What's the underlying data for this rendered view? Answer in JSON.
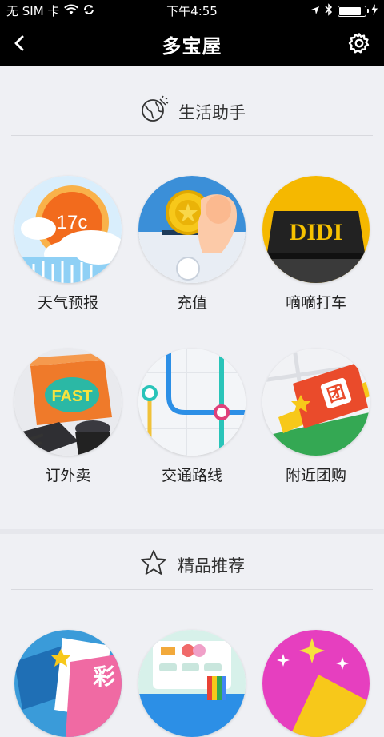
{
  "status_bar": {
    "carrier": "无 SIM 卡",
    "time": "下午4:55",
    "battery_level": 0.9
  },
  "nav": {
    "title": "多宝屋",
    "back_icon": "chevron-left-icon",
    "settings_icon": "gear-icon"
  },
  "sections": [
    {
      "title": "生活助手",
      "icon": "globe-icon",
      "items": [
        {
          "label": "天气预报",
          "icon": "weather-icon",
          "badge_text": "17c"
        },
        {
          "label": "充值",
          "icon": "recharge-coin-icon"
        },
        {
          "label": "嘀嘀打车",
          "icon": "didi-taxi-icon",
          "badge_text": "DIDI"
        },
        {
          "label": "订外卖",
          "icon": "delivery-scooter-icon",
          "badge_text": "FAST"
        },
        {
          "label": "交通路线",
          "icon": "transit-map-icon"
        },
        {
          "label": "附近团购",
          "icon": "group-buy-ticket-icon",
          "badge_text": "团"
        }
      ]
    },
    {
      "title": "精品推荐",
      "icon": "star-outline-icon",
      "items": [
        {
          "icon": "lottery-icon",
          "badge_text": "彩"
        },
        {
          "icon": "cards-app-icon"
        },
        {
          "icon": "sparkle-gift-icon"
        }
      ]
    }
  ],
  "colors": {
    "bar_background": "#000000",
    "page_background": "#eff0f4",
    "weather_orange": "#f26b1d",
    "coin_yellow": "#f7c81a",
    "didi_yellow": "#f5b800",
    "delivery_orange": "#ef7a2a",
    "transit_blue": "#2c8fe6",
    "transit_teal": "#29c4b9",
    "groupbuy_red": "#ea4b2b",
    "groupbuy_green": "#34a853"
  }
}
